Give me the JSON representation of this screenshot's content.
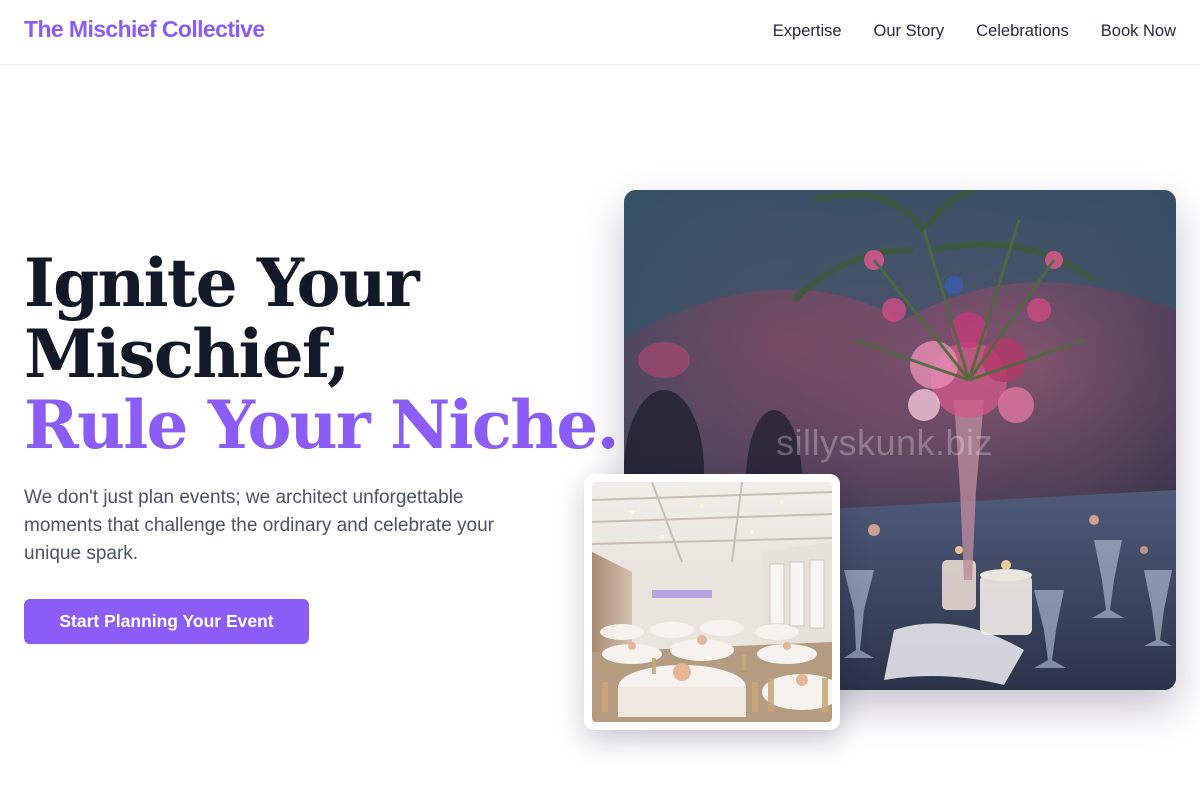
{
  "brand": {
    "name": "The Mischief Collective",
    "color": "#8b5cf6"
  },
  "nav": {
    "items": [
      {
        "label": "Expertise"
      },
      {
        "label": "Our Story"
      },
      {
        "label": "Celebrations"
      },
      {
        "label": "Book Now"
      }
    ]
  },
  "hero": {
    "headline_line1": "Ignite Your",
    "headline_line2": "Mischief,",
    "headline_accent": "Rule Your Niche.",
    "lead": "We don't just plan events; we architect unforgettable moments that challenge the ordinary and celebrate your unique spark.",
    "cta_label": "Start Planning Your Event"
  },
  "images": {
    "main_watermark": "sillyskunk.biz",
    "main_photo_icon": "floral-centerpiece-photo",
    "inset_photo_icon": "banquet-hall-photo"
  },
  "colors": {
    "accent": "#8b5cf6",
    "heading": "#111827",
    "body_text": "#4b5563"
  }
}
